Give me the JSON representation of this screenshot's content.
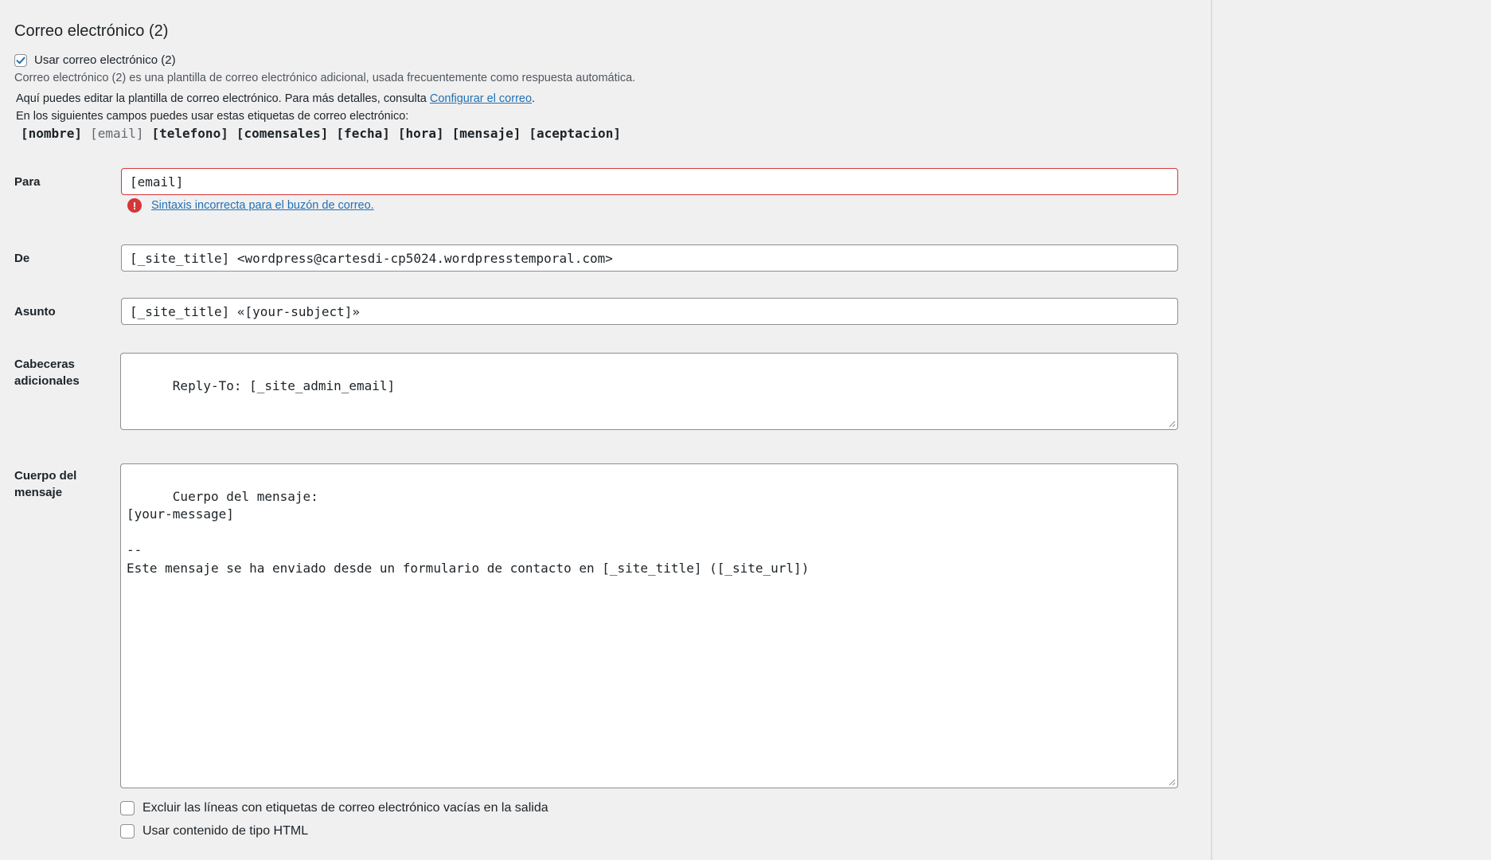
{
  "section": {
    "title": "Correo electrónico (2)",
    "use_checkbox_label": "Usar correo electrónico (2)",
    "use_checked": true,
    "description": "Correo electrónico (2) es una plantilla de correo electrónico adicional, usada frecuentemente como respuesta automática.",
    "info_text": "Aquí puedes editar la plantilla de correo electrónico. Para más detalles, consulta ",
    "info_link": "Configurar el correo",
    "info_end": ".",
    "tags_intro": "En los siguientes campos puedes usar estas etiquetas de correo electrónico:",
    "tags": [
      "[nombre]",
      "[email]",
      "[telefono]",
      "[comensales]",
      "[fecha]",
      "[hora]",
      "[mensaje]",
      "[aceptacion]"
    ]
  },
  "fields": {
    "to_label": "Para",
    "to_value": "[email]",
    "to_error": "Sintaxis incorrecta para el buzón de correo.",
    "from_label": "De",
    "from_value": "[_site_title] <wordpress@cartesdi-cp5024.wordpresstemporal.com>",
    "subject_label": "Asunto",
    "subject_value": "[_site_title] «[your-subject]»",
    "headers_label_1": "Cabeceras",
    "headers_label_2": "adicionales",
    "headers_value": "Reply-To: [_site_admin_email]",
    "body_label_1": "Cuerpo del",
    "body_label_2": "mensaje",
    "body_value": "Cuerpo del mensaje:\n[your-message]\n\n-- \nEste mensaje se ha enviado desde un formulario de contacto en [_site_title] ([_site_url])"
  },
  "options": {
    "exclude_blank_label": "Excluir las líneas con etiquetas de correo electrónico vacías en la salida",
    "exclude_blank_checked": false,
    "html_label": "Usar contenido de tipo HTML",
    "html_checked": false
  },
  "colors": {
    "link": "#2271b1",
    "error": "#d63638",
    "background": "#f0f0f1"
  }
}
